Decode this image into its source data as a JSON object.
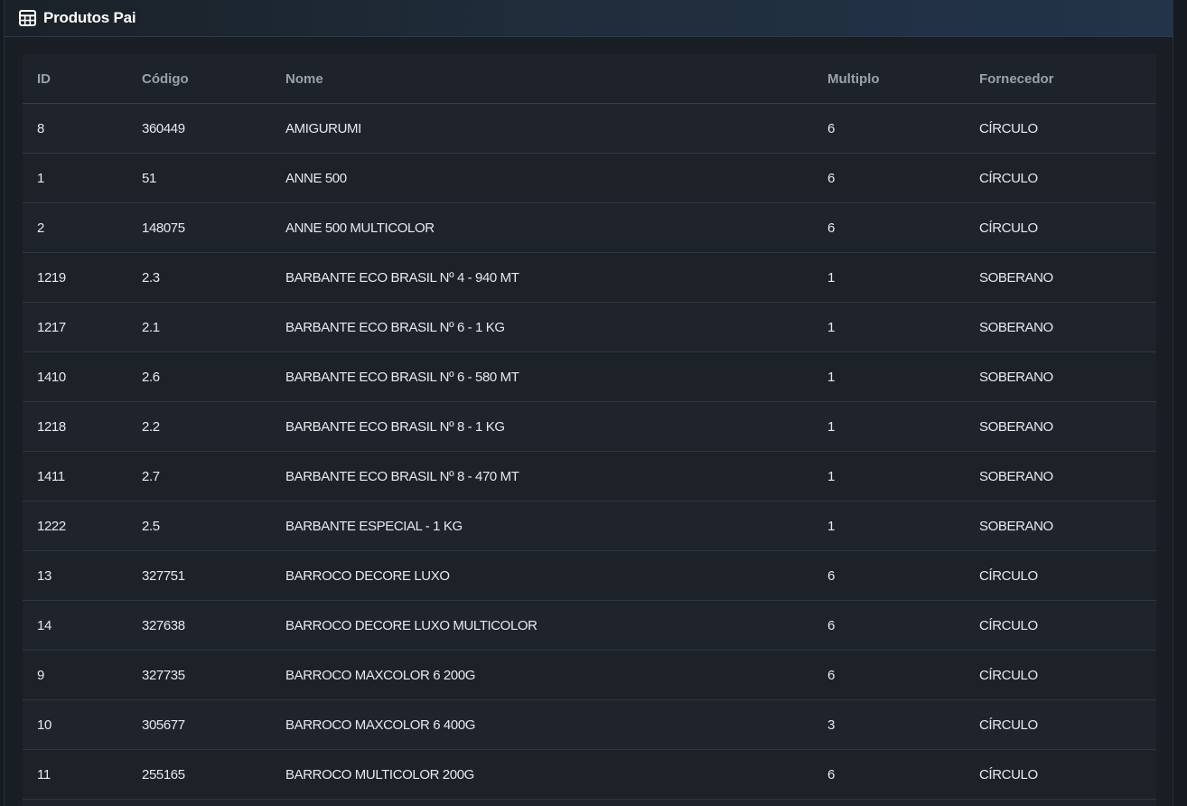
{
  "panel": {
    "title": "Produtos Pai",
    "icon": "table-icon"
  },
  "table": {
    "headers": [
      "ID",
      "Código",
      "Nome",
      "Multiplo",
      "Fornecedor"
    ],
    "rows": [
      [
        "8",
        "360449",
        "AMIGURUMI",
        "6",
        "CÍRCULO"
      ],
      [
        "1",
        "51",
        "ANNE 500",
        "6",
        "CÍRCULO"
      ],
      [
        "2",
        "148075",
        "ANNE 500 MULTICOLOR",
        "6",
        "CÍRCULO"
      ],
      [
        "1219",
        "2.3",
        "BARBANTE ECO BRASIL Nº 4 - 940 MT",
        "1",
        "SOBERANO"
      ],
      [
        "1217",
        "2.1",
        "BARBANTE ECO BRASIL Nº 6 - 1 KG",
        "1",
        "SOBERANO"
      ],
      [
        "1410",
        "2.6",
        "BARBANTE ECO BRASIL Nº 6 - 580 MT",
        "1",
        "SOBERANO"
      ],
      [
        "1218",
        "2.2",
        "BARBANTE ECO BRASIL Nº 8 - 1 KG",
        "1",
        "SOBERANO"
      ],
      [
        "1411",
        "2.7",
        "BARBANTE ECO BRASIL Nº 8 - 470 MT",
        "1",
        "SOBERANO"
      ],
      [
        "1222",
        "2.5",
        "BARBANTE ESPECIAL - 1 KG",
        "1",
        "SOBERANO"
      ],
      [
        "13",
        "327751",
        "BARROCO DECORE LUXO",
        "6",
        "CÍRCULO"
      ],
      [
        "14",
        "327638",
        "BARROCO DECORE LUXO MULTICOLOR",
        "6",
        "CÍRCULO"
      ],
      [
        "9",
        "327735",
        "BARROCO MAXCOLOR 6 200G",
        "6",
        "CÍRCULO"
      ],
      [
        "10",
        "305677",
        "BARROCO MAXCOLOR 6 400G",
        "3",
        "CÍRCULO"
      ],
      [
        "11",
        "255165",
        "BARROCO MULTICOLOR 200G",
        "6",
        "CÍRCULO"
      ]
    ]
  }
}
